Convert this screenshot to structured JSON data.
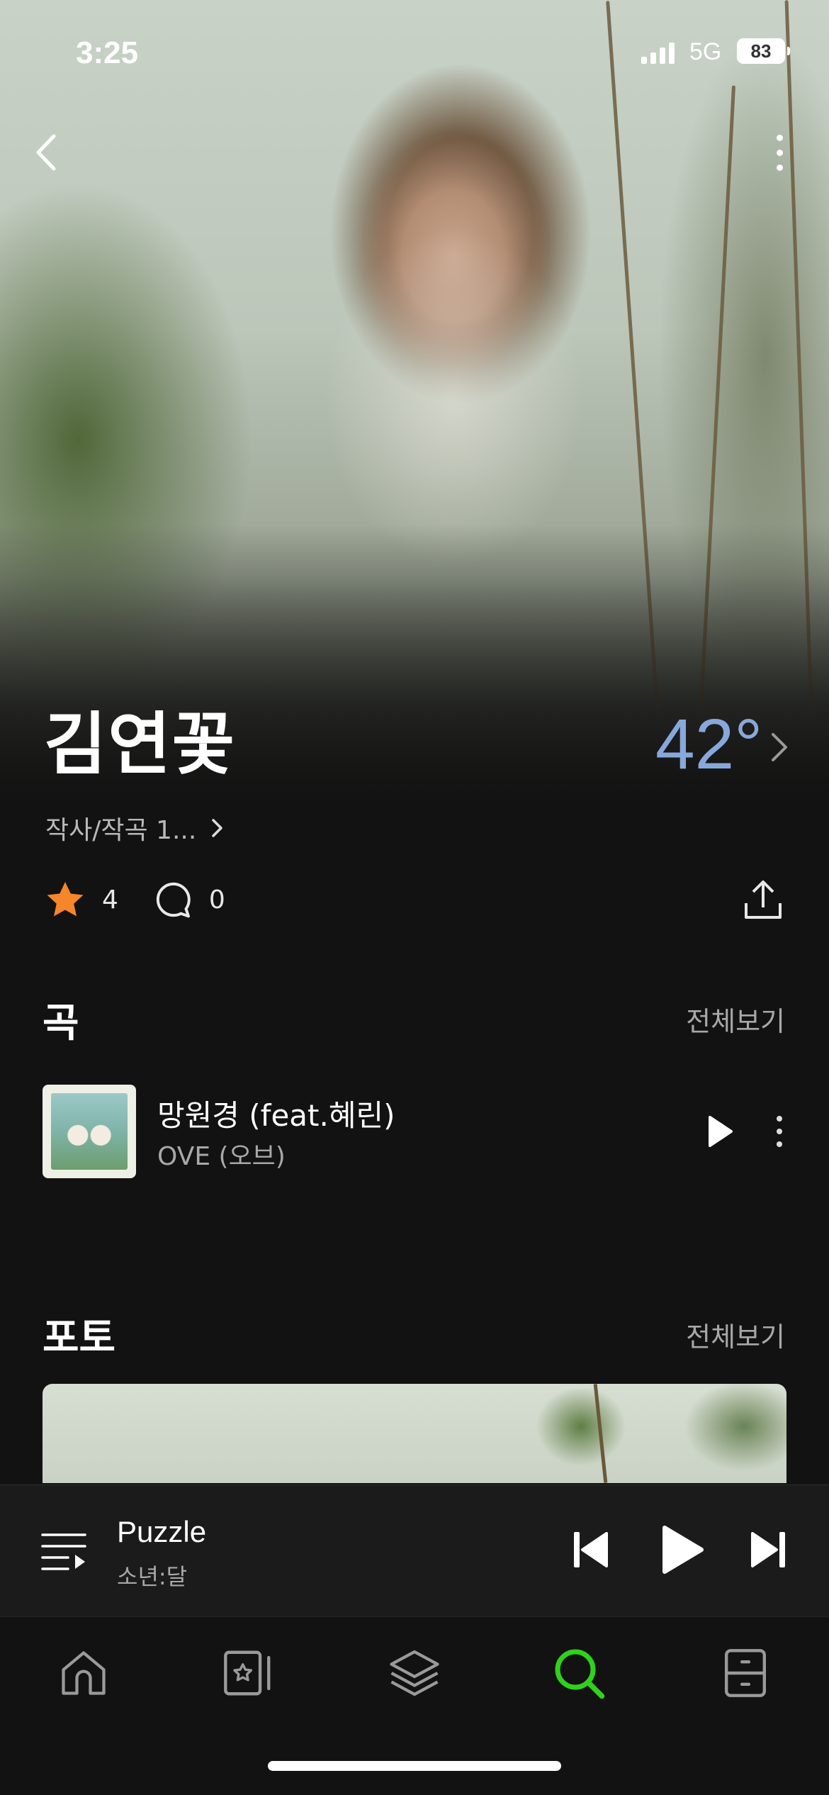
{
  "status_bar": {
    "time": "3:25",
    "network": "5G",
    "battery": "83"
  },
  "artist": {
    "name": "김연꽃",
    "temperature": "42°",
    "role": "작사/작곡 1...",
    "favorites_count": "4",
    "comments_count": "0"
  },
  "songs_section": {
    "title": "곡",
    "see_all": "전체보기",
    "items": [
      {
        "title": "망원경 (feat.혜린)",
        "artist": "OVE (오브)"
      }
    ]
  },
  "photo_section": {
    "title": "포토",
    "see_all": "전체보기"
  },
  "mini_player": {
    "title": "Puzzle",
    "artist": "소년:달"
  },
  "tabs": [
    {
      "icon": "home-icon"
    },
    {
      "icon": "library-star-icon"
    },
    {
      "icon": "layers-icon"
    },
    {
      "icon": "search-icon",
      "active": true
    },
    {
      "icon": "drawer-icon"
    }
  ],
  "colors": {
    "accent_green": "#2fd11d",
    "temperature_blue": "#88a8dc",
    "star_orange": "#f5862a",
    "background": "#121212"
  }
}
